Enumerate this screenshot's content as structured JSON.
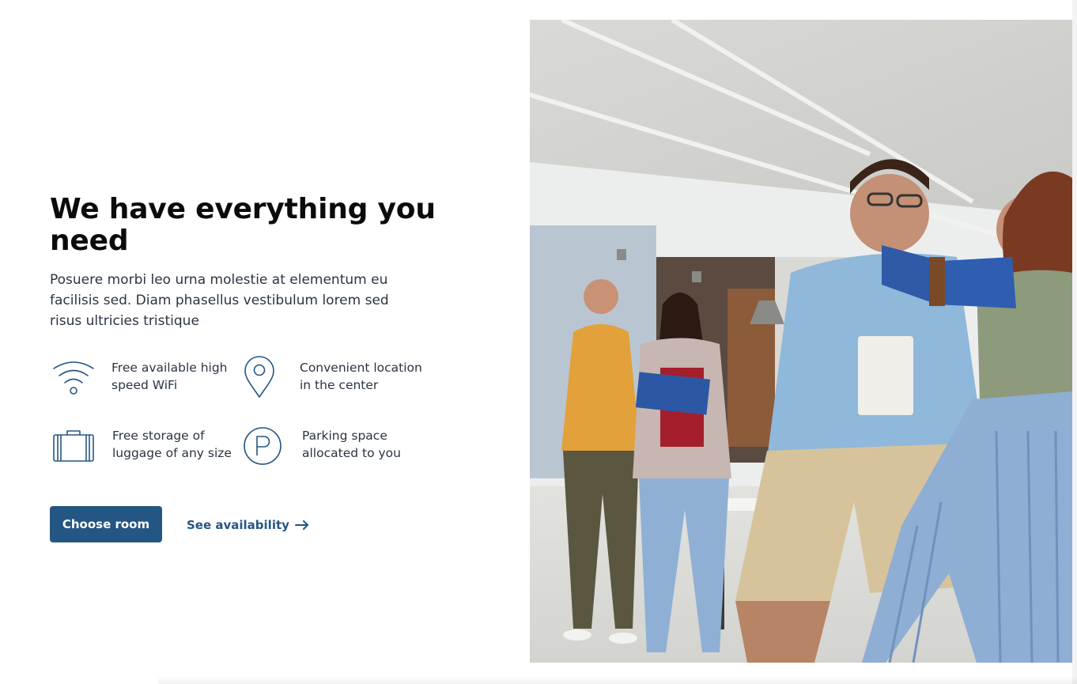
{
  "hero": {
    "title": "We have everything you need",
    "description": "Posuere morbi leo urna molestie at elementum eu facilisis sed. Diam phasellus vestibulum lorem sed risus ultricies tristique"
  },
  "features": [
    {
      "icon": "wifi-icon",
      "text": "Free available high\nspeed WiFi"
    },
    {
      "icon": "location-pin-icon",
      "text": "Convenient location\nin the center"
    },
    {
      "icon": "luggage-icon",
      "text": "Free storage of\nluggage of any size"
    },
    {
      "icon": "parking-icon",
      "text": "Parking space\nallocated to you"
    }
  ],
  "actions": {
    "primary_label": "Choose room",
    "secondary_label": "See availability",
    "secondary_icon": "arrow-right-icon"
  },
  "colors": {
    "accent": "#245684",
    "title": "#0b0b0b",
    "body_text": "#2b3441",
    "background": "#ffffff"
  },
  "photo": {
    "icon": "hero-photo"
  }
}
